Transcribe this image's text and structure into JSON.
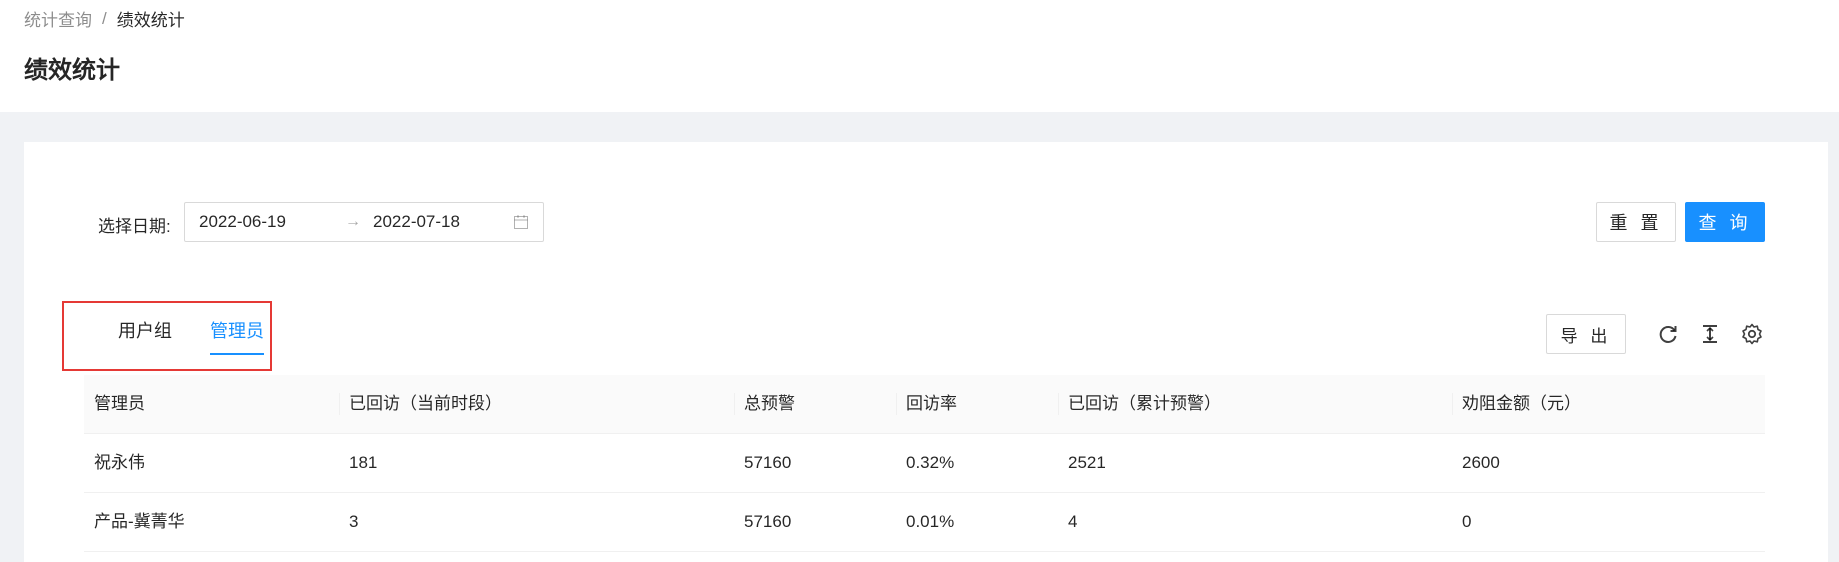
{
  "breadcrumb": {
    "parent": "统计查询",
    "separator": "/",
    "current": "绩效统计"
  },
  "page": {
    "title": "绩效统计"
  },
  "filters": {
    "date_label": "选择日期:",
    "start_date": "2022-06-19",
    "end_date": "2022-07-18",
    "range_separator": "→"
  },
  "buttons": {
    "reset": "重 置",
    "query": "查 询",
    "export": "导 出"
  },
  "tabs": [
    {
      "label": "用户组",
      "active": false
    },
    {
      "label": "管理员",
      "active": true
    }
  ],
  "toolbar_icons": [
    "reload-icon",
    "column-height-icon",
    "setting-icon"
  ],
  "table": {
    "columns": [
      "管理员",
      "已回访（当前时段）",
      "总预警",
      "回访率",
      "已回访（累计预警）",
      "劝阻金额（元）"
    ],
    "rows": [
      [
        "祝永伟",
        "181",
        "57160",
        "0.32%",
        "2521",
        "2600"
      ],
      [
        "产品-冀菁华",
        "3",
        "57160",
        "0.01%",
        "4",
        "0"
      ]
    ]
  },
  "colors": {
    "primary": "#1890ff",
    "highlight_border": "#e53935",
    "background": "#f0f2f5"
  }
}
